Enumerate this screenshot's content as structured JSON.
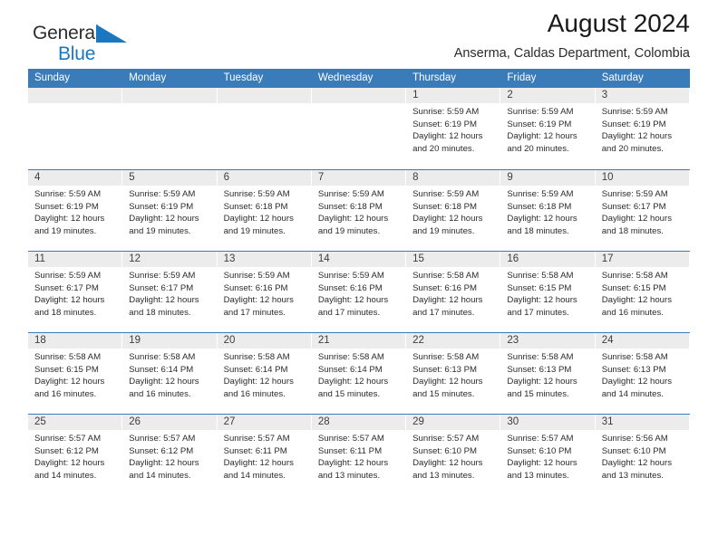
{
  "brand": {
    "name_top": "General",
    "name_bottom": "Blue",
    "triangle_color": "#1a78c2",
    "top_color": "#2e2e2e",
    "bottom_color": "#1a78c2"
  },
  "header": {
    "title": "August 2024",
    "subtitle": "Anserma, Caldas Department, Colombia"
  },
  "theme": {
    "header_blue": "#3a7cb9",
    "day_strip_gray": "#ececec",
    "text_color": "#2b2b2b"
  },
  "weekdays": [
    "Sunday",
    "Monday",
    "Tuesday",
    "Wednesday",
    "Thursday",
    "Friday",
    "Saturday"
  ],
  "weeks": [
    [
      {
        "day": "",
        "empty": true
      },
      {
        "day": "",
        "empty": true
      },
      {
        "day": "",
        "empty": true
      },
      {
        "day": "",
        "empty": true
      },
      {
        "day": "1",
        "sunrise": "Sunrise: 5:59 AM",
        "sunset": "Sunset: 6:19 PM",
        "daylight_l1": "Daylight: 12 hours",
        "daylight_l2": "and 20 minutes."
      },
      {
        "day": "2",
        "sunrise": "Sunrise: 5:59 AM",
        "sunset": "Sunset: 6:19 PM",
        "daylight_l1": "Daylight: 12 hours",
        "daylight_l2": "and 20 minutes."
      },
      {
        "day": "3",
        "sunrise": "Sunrise: 5:59 AM",
        "sunset": "Sunset: 6:19 PM",
        "daylight_l1": "Daylight: 12 hours",
        "daylight_l2": "and 20 minutes."
      }
    ],
    [
      {
        "day": "4",
        "sunrise": "Sunrise: 5:59 AM",
        "sunset": "Sunset: 6:19 PM",
        "daylight_l1": "Daylight: 12 hours",
        "daylight_l2": "and 19 minutes."
      },
      {
        "day": "5",
        "sunrise": "Sunrise: 5:59 AM",
        "sunset": "Sunset: 6:19 PM",
        "daylight_l1": "Daylight: 12 hours",
        "daylight_l2": "and 19 minutes."
      },
      {
        "day": "6",
        "sunrise": "Sunrise: 5:59 AM",
        "sunset": "Sunset: 6:18 PM",
        "daylight_l1": "Daylight: 12 hours",
        "daylight_l2": "and 19 minutes."
      },
      {
        "day": "7",
        "sunrise": "Sunrise: 5:59 AM",
        "sunset": "Sunset: 6:18 PM",
        "daylight_l1": "Daylight: 12 hours",
        "daylight_l2": "and 19 minutes."
      },
      {
        "day": "8",
        "sunrise": "Sunrise: 5:59 AM",
        "sunset": "Sunset: 6:18 PM",
        "daylight_l1": "Daylight: 12 hours",
        "daylight_l2": "and 19 minutes."
      },
      {
        "day": "9",
        "sunrise": "Sunrise: 5:59 AM",
        "sunset": "Sunset: 6:18 PM",
        "daylight_l1": "Daylight: 12 hours",
        "daylight_l2": "and 18 minutes."
      },
      {
        "day": "10",
        "sunrise": "Sunrise: 5:59 AM",
        "sunset": "Sunset: 6:17 PM",
        "daylight_l1": "Daylight: 12 hours",
        "daylight_l2": "and 18 minutes."
      }
    ],
    [
      {
        "day": "11",
        "sunrise": "Sunrise: 5:59 AM",
        "sunset": "Sunset: 6:17 PM",
        "daylight_l1": "Daylight: 12 hours",
        "daylight_l2": "and 18 minutes."
      },
      {
        "day": "12",
        "sunrise": "Sunrise: 5:59 AM",
        "sunset": "Sunset: 6:17 PM",
        "daylight_l1": "Daylight: 12 hours",
        "daylight_l2": "and 18 minutes."
      },
      {
        "day": "13",
        "sunrise": "Sunrise: 5:59 AM",
        "sunset": "Sunset: 6:16 PM",
        "daylight_l1": "Daylight: 12 hours",
        "daylight_l2": "and 17 minutes."
      },
      {
        "day": "14",
        "sunrise": "Sunrise: 5:59 AM",
        "sunset": "Sunset: 6:16 PM",
        "daylight_l1": "Daylight: 12 hours",
        "daylight_l2": "and 17 minutes."
      },
      {
        "day": "15",
        "sunrise": "Sunrise: 5:58 AM",
        "sunset": "Sunset: 6:16 PM",
        "daylight_l1": "Daylight: 12 hours",
        "daylight_l2": "and 17 minutes."
      },
      {
        "day": "16",
        "sunrise": "Sunrise: 5:58 AM",
        "sunset": "Sunset: 6:15 PM",
        "daylight_l1": "Daylight: 12 hours",
        "daylight_l2": "and 17 minutes."
      },
      {
        "day": "17",
        "sunrise": "Sunrise: 5:58 AM",
        "sunset": "Sunset: 6:15 PM",
        "daylight_l1": "Daylight: 12 hours",
        "daylight_l2": "and 16 minutes."
      }
    ],
    [
      {
        "day": "18",
        "sunrise": "Sunrise: 5:58 AM",
        "sunset": "Sunset: 6:15 PM",
        "daylight_l1": "Daylight: 12 hours",
        "daylight_l2": "and 16 minutes."
      },
      {
        "day": "19",
        "sunrise": "Sunrise: 5:58 AM",
        "sunset": "Sunset: 6:14 PM",
        "daylight_l1": "Daylight: 12 hours",
        "daylight_l2": "and 16 minutes."
      },
      {
        "day": "20",
        "sunrise": "Sunrise: 5:58 AM",
        "sunset": "Sunset: 6:14 PM",
        "daylight_l1": "Daylight: 12 hours",
        "daylight_l2": "and 16 minutes."
      },
      {
        "day": "21",
        "sunrise": "Sunrise: 5:58 AM",
        "sunset": "Sunset: 6:14 PM",
        "daylight_l1": "Daylight: 12 hours",
        "daylight_l2": "and 15 minutes."
      },
      {
        "day": "22",
        "sunrise": "Sunrise: 5:58 AM",
        "sunset": "Sunset: 6:13 PM",
        "daylight_l1": "Daylight: 12 hours",
        "daylight_l2": "and 15 minutes."
      },
      {
        "day": "23",
        "sunrise": "Sunrise: 5:58 AM",
        "sunset": "Sunset: 6:13 PM",
        "daylight_l1": "Daylight: 12 hours",
        "daylight_l2": "and 15 minutes."
      },
      {
        "day": "24",
        "sunrise": "Sunrise: 5:58 AM",
        "sunset": "Sunset: 6:13 PM",
        "daylight_l1": "Daylight: 12 hours",
        "daylight_l2": "and 14 minutes."
      }
    ],
    [
      {
        "day": "25",
        "sunrise": "Sunrise: 5:57 AM",
        "sunset": "Sunset: 6:12 PM",
        "daylight_l1": "Daylight: 12 hours",
        "daylight_l2": "and 14 minutes."
      },
      {
        "day": "26",
        "sunrise": "Sunrise: 5:57 AM",
        "sunset": "Sunset: 6:12 PM",
        "daylight_l1": "Daylight: 12 hours",
        "daylight_l2": "and 14 minutes."
      },
      {
        "day": "27",
        "sunrise": "Sunrise: 5:57 AM",
        "sunset": "Sunset: 6:11 PM",
        "daylight_l1": "Daylight: 12 hours",
        "daylight_l2": "and 14 minutes."
      },
      {
        "day": "28",
        "sunrise": "Sunrise: 5:57 AM",
        "sunset": "Sunset: 6:11 PM",
        "daylight_l1": "Daylight: 12 hours",
        "daylight_l2": "and 13 minutes."
      },
      {
        "day": "29",
        "sunrise": "Sunrise: 5:57 AM",
        "sunset": "Sunset: 6:10 PM",
        "daylight_l1": "Daylight: 12 hours",
        "daylight_l2": "and 13 minutes."
      },
      {
        "day": "30",
        "sunrise": "Sunrise: 5:57 AM",
        "sunset": "Sunset: 6:10 PM",
        "daylight_l1": "Daylight: 12 hours",
        "daylight_l2": "and 13 minutes."
      },
      {
        "day": "31",
        "sunrise": "Sunrise: 5:56 AM",
        "sunset": "Sunset: 6:10 PM",
        "daylight_l1": "Daylight: 12 hours",
        "daylight_l2": "and 13 minutes."
      }
    ]
  ]
}
